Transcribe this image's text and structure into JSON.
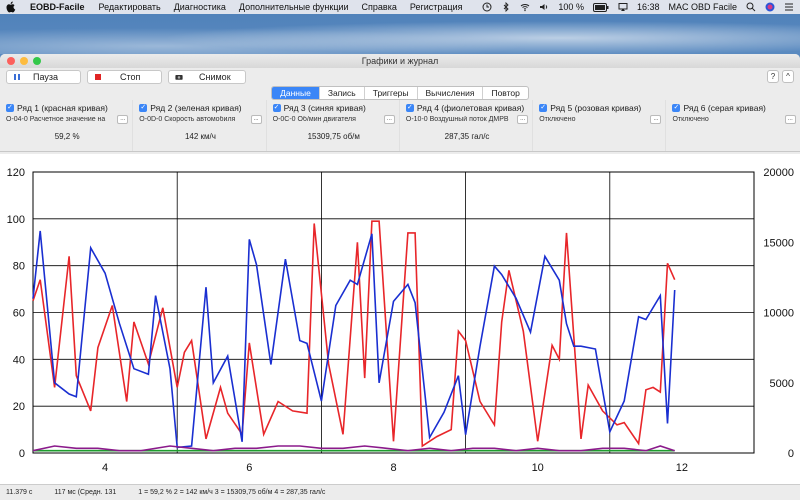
{
  "menubar": {
    "app_name": "EOBD-Facile",
    "items": [
      "Редактировать",
      "Диагностика",
      "Дополнительные функции",
      "Справка",
      "Регистрация"
    ],
    "battery": "100 %",
    "time": "16:38",
    "right_label": "MAC OBD Facile"
  },
  "window": {
    "title": "Графики и журнал"
  },
  "toolbar": {
    "pause_label": "Пауза",
    "stop_label": "Стоп",
    "snapshot_label": "Снимок",
    "help_label": "?",
    "collapse_label": "^"
  },
  "tabs": [
    {
      "label": "Данные",
      "active": true
    },
    {
      "label": "Запись",
      "active": false
    },
    {
      "label": "Триггеры",
      "active": false
    },
    {
      "label": "Вычисления",
      "active": false
    },
    {
      "label": "Повтор",
      "active": false
    }
  ],
  "series": [
    {
      "label": "Ряд 1 (красная кривая)",
      "param": "О-04-0 Расчетное значение на",
      "value": "59,2 %",
      "color": "#e8262a"
    },
    {
      "label": "Ряд 2 (зеленая кривая)",
      "param": "О-0D-0 Скорость автомобиля",
      "value": "142 км/ч",
      "color": "#1e9e2e"
    },
    {
      "label": "Ряд 3 (синяя кривая)",
      "param": "О-0C-0 Об/мин двигателя",
      "value": "15309,75 об/м",
      "color": "#1a2fd1"
    },
    {
      "label": "Ряд 4 (фиолетовая кривая)",
      "param": "О-10-0 Воздушный поток ДМРВ",
      "value": "287,35 гал/с",
      "color": "#8b1a8b"
    },
    {
      "label": "Ряд 5 (розовая кривая)",
      "param": "Отключено",
      "value": "",
      "color": "#e87ad0"
    },
    {
      "label": "Ряд 6 (серая кривая)",
      "param": "Отключено",
      "value": "",
      "color": "#888888"
    }
  ],
  "dots_label": "...",
  "status": {
    "time": "11.379 с",
    "avg": "117 мс (Средн. 131",
    "readout": "1 = 59,2 %  2 = 142 км/ч  3 = 15309,75 об/м  4 = 287,35 гал/с"
  },
  "chart_data": {
    "type": "line",
    "x_range": [
      3,
      13
    ],
    "x_ticks": [
      "4",
      "6",
      "8",
      "10",
      "12"
    ],
    "y_left_range": [
      0,
      120
    ],
    "y_left_ticks": [
      "0",
      "20",
      "40",
      "60",
      "80",
      "100",
      "120"
    ],
    "y_right_range": [
      0,
      20000
    ],
    "y_right_ticks": [
      "0",
      "5000",
      "10000",
      "15000",
      "20000"
    ],
    "grid": true,
    "series": [
      {
        "color": "#e8262a",
        "axis": "left",
        "points": [
          [
            3.0,
            65
          ],
          [
            3.1,
            74
          ],
          [
            3.3,
            28
          ],
          [
            3.5,
            84
          ],
          [
            3.6,
            33
          ],
          [
            3.8,
            18
          ],
          [
            3.9,
            45
          ],
          [
            4.1,
            63
          ],
          [
            4.3,
            22
          ],
          [
            4.4,
            56
          ],
          [
            4.6,
            38
          ],
          [
            4.8,
            62
          ],
          [
            5.0,
            28
          ],
          [
            5.1,
            43
          ],
          [
            5.2,
            48
          ],
          [
            5.4,
            6
          ],
          [
            5.6,
            28
          ],
          [
            5.7,
            17
          ],
          [
            5.9,
            8
          ],
          [
            6.0,
            47
          ],
          [
            6.2,
            8
          ],
          [
            6.4,
            22
          ],
          [
            6.6,
            18
          ],
          [
            6.8,
            17
          ],
          [
            6.9,
            98
          ],
          [
            7.1,
            38
          ],
          [
            7.3,
            8
          ],
          [
            7.5,
            90
          ],
          [
            7.6,
            32
          ],
          [
            7.7,
            99
          ],
          [
            7.8,
            99
          ],
          [
            8.0,
            5
          ],
          [
            8.2,
            94
          ],
          [
            8.3,
            94
          ],
          [
            8.4,
            3
          ],
          [
            8.6,
            7
          ],
          [
            8.8,
            10
          ],
          [
            8.9,
            52
          ],
          [
            9.0,
            48
          ],
          [
            9.2,
            22
          ],
          [
            9.4,
            12
          ],
          [
            9.5,
            56
          ],
          [
            9.6,
            78
          ],
          [
            9.8,
            52
          ],
          [
            10.0,
            5
          ],
          [
            10.2,
            46
          ],
          [
            10.3,
            40
          ],
          [
            10.4,
            94
          ],
          [
            10.6,
            6
          ],
          [
            10.7,
            29
          ],
          [
            10.9,
            18
          ],
          [
            11.1,
            12
          ],
          [
            11.2,
            13
          ],
          [
            11.4,
            4
          ],
          [
            11.5,
            27
          ],
          [
            11.6,
            28
          ],
          [
            11.7,
            26
          ],
          [
            11.8,
            81
          ],
          [
            11.9,
            74
          ]
        ]
      },
      {
        "color": "#1e9e2e",
        "axis": "left",
        "points": [
          [
            3.0,
            1
          ],
          [
            3.5,
            1
          ],
          [
            4.0,
            1
          ],
          [
            4.5,
            1
          ],
          [
            5.0,
            1
          ],
          [
            5.5,
            1
          ],
          [
            6.0,
            1
          ],
          [
            6.5,
            1
          ],
          [
            7.0,
            1
          ],
          [
            7.5,
            1
          ],
          [
            8.0,
            1
          ],
          [
            8.5,
            1
          ],
          [
            9.0,
            1
          ],
          [
            9.5,
            1
          ],
          [
            10.0,
            1
          ],
          [
            10.5,
            1
          ],
          [
            11.0,
            1
          ],
          [
            11.5,
            1
          ],
          [
            11.9,
            1
          ]
        ]
      },
      {
        "color": "#1a2fd1",
        "axis": "right",
        "points": [
          [
            3.0,
            11000
          ],
          [
            3.1,
            15800
          ],
          [
            3.3,
            5000
          ],
          [
            3.5,
            4200
          ],
          [
            3.6,
            4000
          ],
          [
            3.8,
            14600
          ],
          [
            4.0,
            12800
          ],
          [
            4.2,
            9200
          ],
          [
            4.4,
            6000
          ],
          [
            4.6,
            5600
          ],
          [
            4.7,
            11200
          ],
          [
            4.9,
            6000
          ],
          [
            5.0,
            400
          ],
          [
            5.2,
            500
          ],
          [
            5.4,
            11800
          ],
          [
            5.5,
            5000
          ],
          [
            5.7,
            6900
          ],
          [
            5.9,
            800
          ],
          [
            6.0,
            15200
          ],
          [
            6.1,
            13400
          ],
          [
            6.3,
            6300
          ],
          [
            6.5,
            13800
          ],
          [
            6.7,
            8000
          ],
          [
            6.8,
            7800
          ],
          [
            7.0,
            3700
          ],
          [
            7.2,
            10500
          ],
          [
            7.4,
            12300
          ],
          [
            7.5,
            12000
          ],
          [
            7.7,
            15600
          ],
          [
            7.8,
            5000
          ],
          [
            8.0,
            10800
          ],
          [
            8.2,
            12000
          ],
          [
            8.3,
            10700
          ],
          [
            8.5,
            1100
          ],
          [
            8.7,
            2900
          ],
          [
            8.9,
            5500
          ],
          [
            9.0,
            1300
          ],
          [
            9.2,
            7600
          ],
          [
            9.4,
            13300
          ],
          [
            9.5,
            12700
          ],
          [
            9.7,
            11000
          ],
          [
            9.9,
            8600
          ],
          [
            10.1,
            14000
          ],
          [
            10.3,
            12300
          ],
          [
            10.4,
            9200
          ],
          [
            10.5,
            7600
          ],
          [
            10.6,
            7600
          ],
          [
            10.8,
            7400
          ],
          [
            11.0,
            1500
          ],
          [
            11.2,
            3700
          ],
          [
            11.4,
            9700
          ],
          [
            11.5,
            9500
          ],
          [
            11.7,
            11200
          ],
          [
            11.8,
            2100
          ],
          [
            11.9,
            11600
          ]
        ]
      },
      {
        "color": "#8b1a8b",
        "axis": "left",
        "points": [
          [
            3.0,
            1
          ],
          [
            3.3,
            3
          ],
          [
            3.6,
            2
          ],
          [
            3.9,
            2
          ],
          [
            4.2,
            1
          ],
          [
            4.5,
            1
          ],
          [
            4.9,
            3
          ],
          [
            5.2,
            2
          ],
          [
            5.5,
            1
          ],
          [
            5.8,
            2
          ],
          [
            6.1,
            2
          ],
          [
            6.4,
            3
          ],
          [
            6.7,
            3
          ],
          [
            7.0,
            2
          ],
          [
            7.3,
            2
          ],
          [
            7.6,
            3
          ],
          [
            7.9,
            2
          ],
          [
            8.2,
            1
          ],
          [
            8.5,
            2
          ],
          [
            8.8,
            1
          ],
          [
            9.1,
            2
          ],
          [
            9.4,
            2
          ],
          [
            9.7,
            1
          ],
          [
            10.0,
            2
          ],
          [
            10.3,
            1
          ],
          [
            10.6,
            1
          ],
          [
            10.9,
            2
          ],
          [
            11.2,
            2
          ],
          [
            11.5,
            1
          ],
          [
            11.7,
            3
          ],
          [
            11.9,
            1
          ]
        ]
      }
    ]
  }
}
